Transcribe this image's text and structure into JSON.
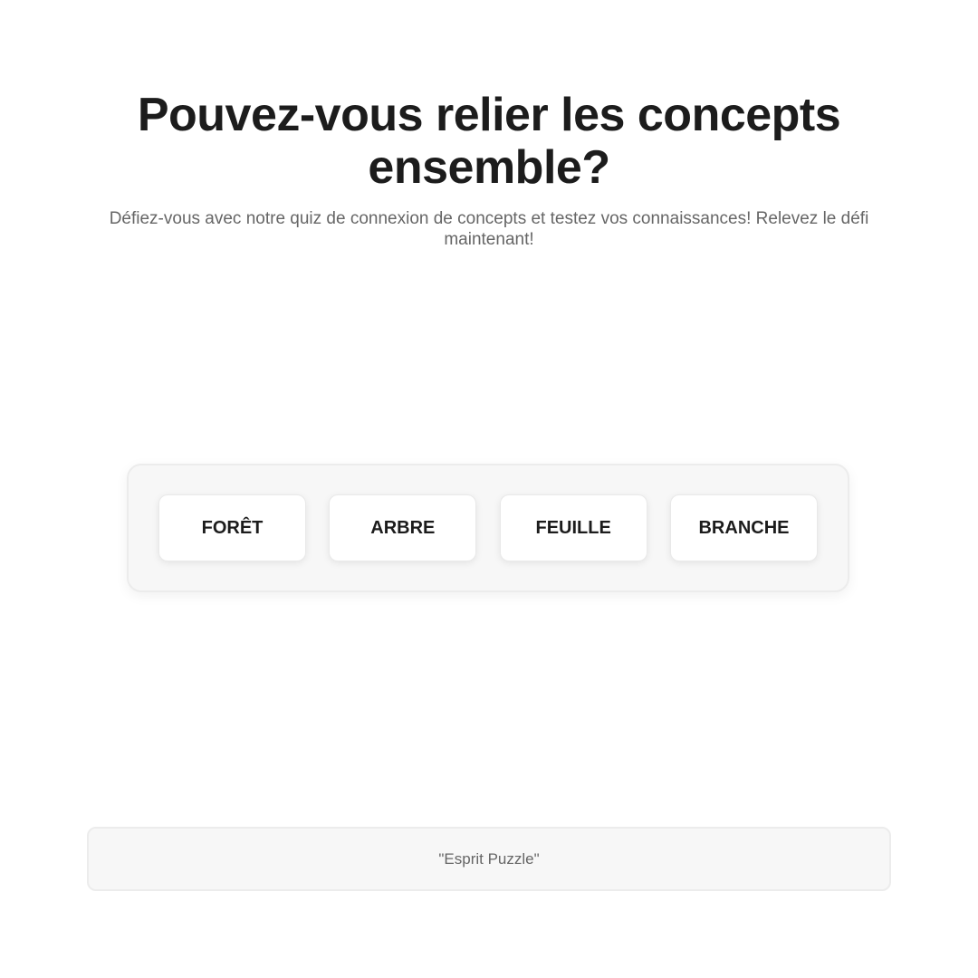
{
  "header": {
    "title": "Pouvez-vous relier les concepts ensemble?",
    "subtitle": "Défiez-vous avec notre quiz de connexion de concepts et testez vos connaissances! Relevez le défi maintenant!"
  },
  "board": {
    "tiles": [
      {
        "label": "FORÊT"
      },
      {
        "label": "ARBRE"
      },
      {
        "label": "FEUILLE"
      },
      {
        "label": "BRANCHE"
      }
    ]
  },
  "footer": {
    "text": "\"Esprit Puzzle\""
  },
  "colors": {
    "text": "#1c1c1c",
    "muted": "#666666",
    "panel": "#f7f7f7",
    "border": "#ececec"
  }
}
